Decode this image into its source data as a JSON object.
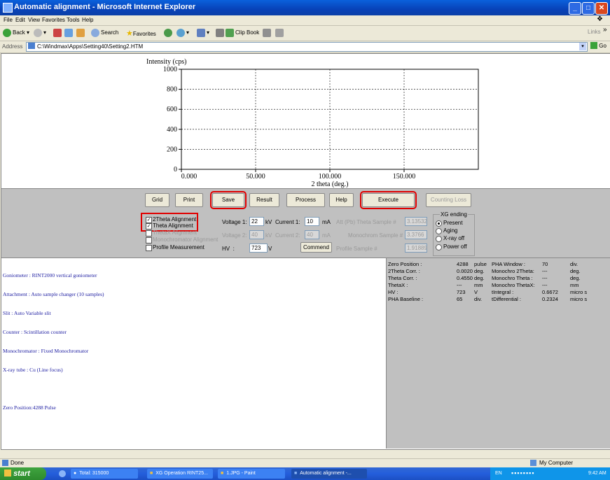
{
  "window": {
    "title": "Automatic alignment - Microsoft Internet Explorer"
  },
  "menu": [
    "File",
    "Edit",
    "View",
    "Favorites",
    "Tools",
    "Help"
  ],
  "toolbar": {
    "back": "Back",
    "search": "Search",
    "favorites": "Favorites",
    "clipbook": "Clip Book",
    "links": "Links"
  },
  "address": {
    "label": "Address",
    "value": "C:\\Windmax\\Apps\\Setting40\\Setting2.HTM",
    "go": "Go"
  },
  "chart_data": {
    "type": "line",
    "ylabel": "Intensity (cps)",
    "xlabel": "2 theta (deg.)",
    "xlim": [
      0,
      200
    ],
    "ylim": [
      0,
      1000
    ],
    "x_ticks": [
      "0.000",
      "50.000",
      "100.000",
      "150.000"
    ],
    "y_ticks": [
      "0",
      "200",
      "400",
      "600",
      "800",
      "1000"
    ],
    "grid": true,
    "series": []
  },
  "controls": {
    "buttons": {
      "grid": "Grid",
      "print": "Print",
      "save": "Save",
      "result": "Result",
      "process": "Process",
      "help": "Help",
      "execute": "Execute",
      "counting_loss": "Counting Loss"
    },
    "checks": {
      "theta2": "2Theta Alignment",
      "theta": "Theta Alignment",
      "theta_x": "ThetaX Alignment",
      "mono": "Monochromator Alignment",
      "profile": "Profile Measurement"
    },
    "voltage1_label": "Voltage 1:",
    "voltage1": "22",
    "kv": "kV",
    "current1_label": "Current 1:",
    "current1": "10",
    "ma": "mA",
    "voltage2_label": "Voltage 2:",
    "voltage2": "40",
    "current2_label": "Current 2:",
    "current2": "40",
    "hv_label": "HV",
    "hv": "723",
    "v": "V",
    "commend": "Commend",
    "att_label": "Att (Pb) Theta Sample #",
    "att_value": "3.13532",
    "mono_label": "Monochrom Sample #",
    "mono_value": "3.3766",
    "profile_label": "Profile Sample #",
    "profile_value": "1.91889",
    "ending": {
      "title": "XG ending",
      "present": "Present",
      "aging": "Aging",
      "xray_off": "X-ray off",
      "power_off": "Power off"
    }
  },
  "info": [
    "Goniometer : RINT2000 vertical goniometer",
    "Attachment : Auto sample changer (10 samples)",
    "Slit : Auto Variable slit",
    "Counter : Scintillation counter",
    "Monochromator : Fixed Monochromator",
    "X-ray tube : Cu (Line focus)",
    "",
    "Zero Position:4288 Pulse"
  ],
  "status_rows": [
    [
      "Zero Position :",
      "4288",
      "pulse",
      "PHA Window :",
      "70",
      "div."
    ],
    [
      "2Theta Corr. :",
      "0.0020",
      "deg.",
      "Monochro 2Theta:",
      "---",
      "deg."
    ],
    [
      "Theta Corr. :",
      "0.4550",
      "deg.",
      "Monochro Theta :",
      "---",
      "deg."
    ],
    [
      "ThetaX :",
      "---",
      "mm",
      "Monochro ThetaX:",
      "---",
      "mm"
    ],
    [
      "HV :",
      "723",
      "V",
      "tIntegral :",
      "0.6672",
      "micro s"
    ],
    [
      "PHA Baseline :",
      "65",
      "div.",
      "tDifferential :",
      "0.2324",
      "micro s"
    ]
  ],
  "statusbar": {
    "left": "Done",
    "right": "My Computer"
  },
  "taskbar": {
    "start": "start",
    "tasks": [
      "Total: 315000",
      "XG Operation RINT25...",
      "1.JPG - Paint",
      "Automatic alignment -..."
    ],
    "lang": "EN",
    "clock": "9:42 AM"
  },
  "colors": {
    "highlight": "#e00000",
    "info_text": "#1a1aa0",
    "panel": "#c0c0c0"
  }
}
